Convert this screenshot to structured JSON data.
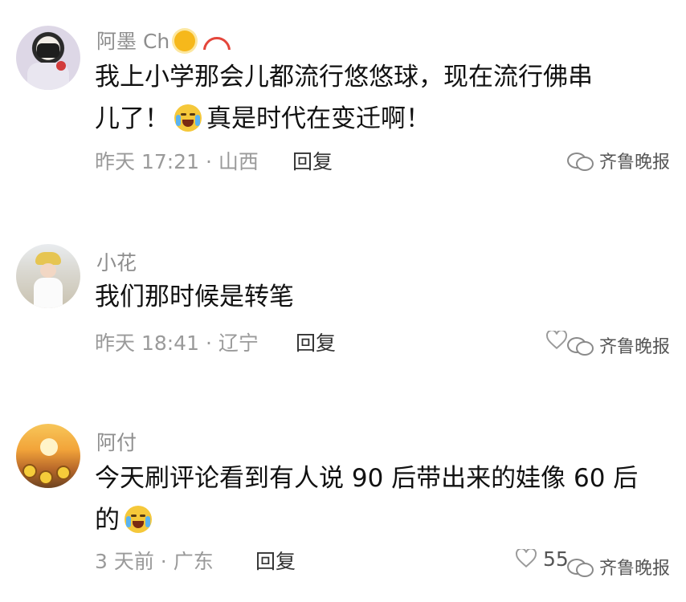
{
  "comments": [
    {
      "username": "阿墨 Ch",
      "content_line1": "我上小学那会儿都流行悠悠球，现在流行佛串",
      "content_line2a": "儿了！",
      "content_line2b": "真是时代在变迁啊！",
      "meta": "昨天 17:21 · 山西",
      "reply": "回复"
    },
    {
      "username": "小花",
      "content_line1": "我们那时候是转笔",
      "meta": "昨天 18:41 · 辽宁",
      "reply": "回复"
    },
    {
      "username": "阿付",
      "content_line1": "今天刷评论看到有人说 90 后带出来的娃像 60 后",
      "content_line2a": "的",
      "meta": "3 天前 · 广东",
      "reply": "回复",
      "likes": "55"
    }
  ],
  "watermark": "齐鲁晚报",
  "icons": [
    "sun-emoji",
    "rainbow-emoji",
    "crying-laughing-emoji",
    "heart-icon",
    "wechat-icon"
  ]
}
